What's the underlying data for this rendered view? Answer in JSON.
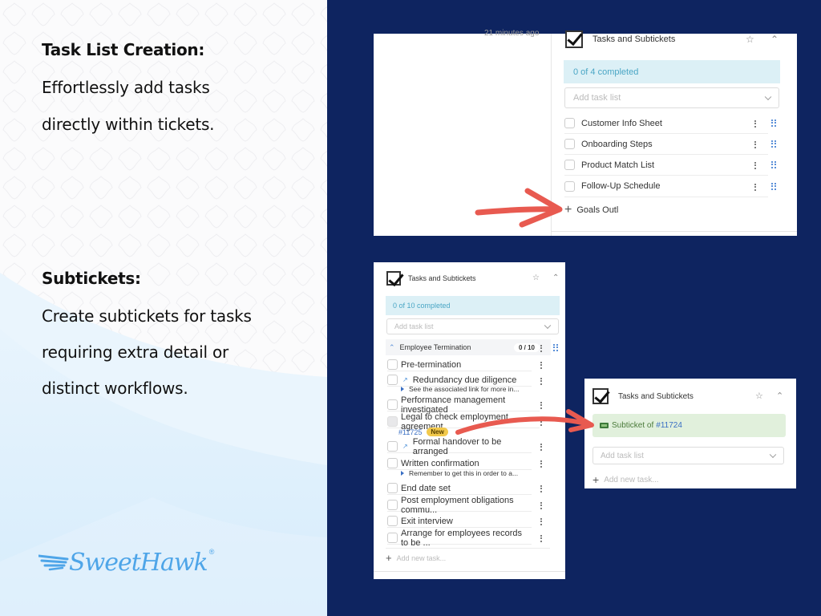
{
  "left": {
    "section1": {
      "heading": "Task List Creation:",
      "lines": [
        "Effortlessly add tasks",
        "directly within tickets."
      ]
    },
    "section2": {
      "heading": "Subtickets:",
      "lines": [
        "Create subtickets for tasks",
        "requiring extra detail or",
        "distinct workflows."
      ]
    },
    "logo": {
      "text": "SweetHawk",
      "reg": "®"
    }
  },
  "colors": {
    "navy": "#0e2460",
    "accent_red": "#e85a50",
    "logo_blue": "#4ea5e8",
    "completed_bg": "#dcf0f6",
    "completed_text": "#4aa6c5",
    "subticket_bg": "#e1f0dc",
    "badge_yellow": "#f2c94c"
  },
  "card1": {
    "timestamp": "21 minutes ago",
    "title": "Tasks and Subtickets",
    "completed": "0 of 4 completed",
    "select_placeholder": "Add task list",
    "tasks": [
      "Customer Info Sheet",
      "Onboarding Steps",
      "Product Match List",
      "Follow-Up Schedule"
    ],
    "add_input_value": "Goals Outl"
  },
  "card2": {
    "title": "Tasks and Subtickets",
    "completed": "0 of 10 completed",
    "select_placeholder": "Add task list",
    "group": {
      "name": "Employee Termination",
      "count": "0 / 10"
    },
    "tasks": [
      {
        "label": "Pre-termination"
      },
      {
        "label": "Redundancy due diligence",
        "note": "See the associated link for more in..."
      },
      {
        "label": "Performance management investigated"
      },
      {
        "label": "Legal to check employment agreement",
        "link": "#11725",
        "badge": "New"
      },
      {
        "label": "Formal handover to be arranged"
      },
      {
        "label": "Written confirmation",
        "note": "Remember to get this in order to a..."
      },
      {
        "label": "End date set"
      },
      {
        "label": "Post employment obligations commu..."
      },
      {
        "label": "Exit interview"
      },
      {
        "label": "Arrange for employees records to be ..."
      }
    ],
    "add_placeholder": "Add new task..."
  },
  "card3": {
    "title": "Tasks and Subtickets",
    "subticket_prefix": "Subticket of ",
    "subticket_link": "#11724",
    "select_placeholder": "Add task list",
    "add_placeholder": "Add new task..."
  }
}
